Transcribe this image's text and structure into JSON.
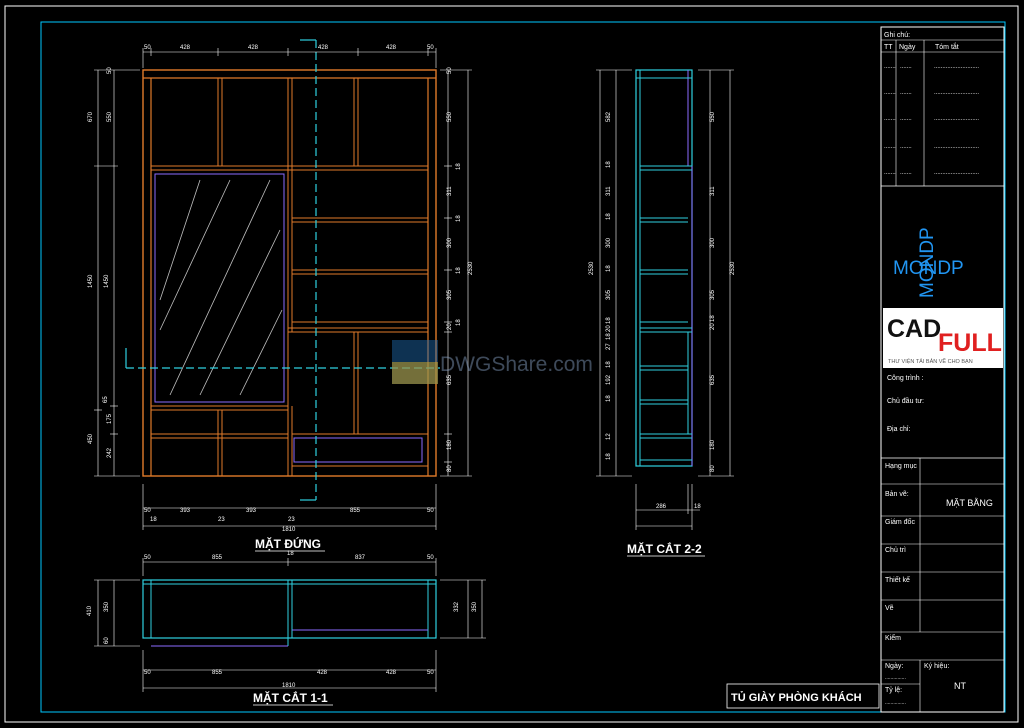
{
  "colors": {
    "border": "#ffffff",
    "frame_inner": "#00c8ff",
    "cabinet": "#e07a2a",
    "cabinet_inner": "#8b6cff",
    "section": "#2fd0e0",
    "dim": "#ffffff",
    "mirror": "#c0c0c0",
    "mondp_blue": "#2196f3",
    "cad_red": "#e02020"
  },
  "views": {
    "front": {
      "label": "MẶT ĐỨNG",
      "top_dims": [
        "50",
        "428",
        "428",
        "428",
        "428",
        "50"
      ],
      "bottom_dims": [
        "50",
        "393",
        "393",
        "855",
        "50"
      ],
      "bottom_gaps": [
        "18",
        "23",
        "23"
      ],
      "total": "1810",
      "left_dims": [
        "50",
        "550",
        "1450",
        "1450",
        "175",
        "242",
        "450",
        "670",
        "65"
      ],
      "right_dims": [
        "50",
        "550",
        "311",
        "300",
        "305",
        "20",
        "635",
        "180",
        "80",
        "2530",
        "18",
        "18",
        "18",
        "18"
      ]
    },
    "section22": {
      "label": "MẶT CẮT 2-2",
      "bottom_dims": [
        "286",
        "18"
      ],
      "left_dims": [
        "582",
        "18",
        "311",
        "18",
        "300",
        "18",
        "305",
        "18",
        "20",
        "18",
        "27",
        "18",
        "192",
        "18",
        "12",
        "18",
        "2530"
      ],
      "right_dims": [
        "550",
        "311",
        "300",
        "305",
        "20",
        "18",
        "635",
        "180",
        "80",
        "2530"
      ]
    },
    "section11": {
      "label": "MẶT CẮT 1-1",
      "top_dims": [
        "50",
        "855",
        "18",
        "837",
        "50"
      ],
      "bottom_dims": [
        "50",
        "855",
        "428",
        "428",
        "50"
      ],
      "total": "1810",
      "left_dims": [
        "410",
        "350",
        "60"
      ],
      "right_dims": [
        "332",
        "350"
      ]
    }
  },
  "watermark": "DWGShare.com",
  "title_block": {
    "notes_header": "Ghi chú:",
    "col_tt": "TT",
    "col_ngay": "Ngày",
    "col_tomtat": "Tóm tắt",
    "blank_row": ".......",
    "blank_row_long": "...........................",
    "mondp_h": "MONDP",
    "mondp_v": "MONDP",
    "cad": "CAD",
    "full": "FULL",
    "cad_sub": "THƯ VIỆN TẢI BẢN VẼ CHO BẠN",
    "cong_trinh": "Công trình :",
    "chu_dau_tu": "Chủ đầu tư:",
    "dia_chi": "Địa chỉ:",
    "hang_muc": "Hạng mục",
    "ban_ve": "Bản vẽ:",
    "ban_ve_value": "MẶT BẰNG",
    "giam_doc": "Giám đốc",
    "chu_tri": "Chủ trì",
    "thiet_ke": "Thiết kế",
    "ve": "Vẽ",
    "kiem": "Kiểm",
    "ngay": "Ngày:",
    "ty_le": "Tỷ lệ:",
    "ky_hieu": "Ký hiệu:",
    "ky_hieu_value": "NT",
    "dotted": "..............."
  },
  "drawing_title": "TỦ GIÀY PHÒNG KHÁCH"
}
